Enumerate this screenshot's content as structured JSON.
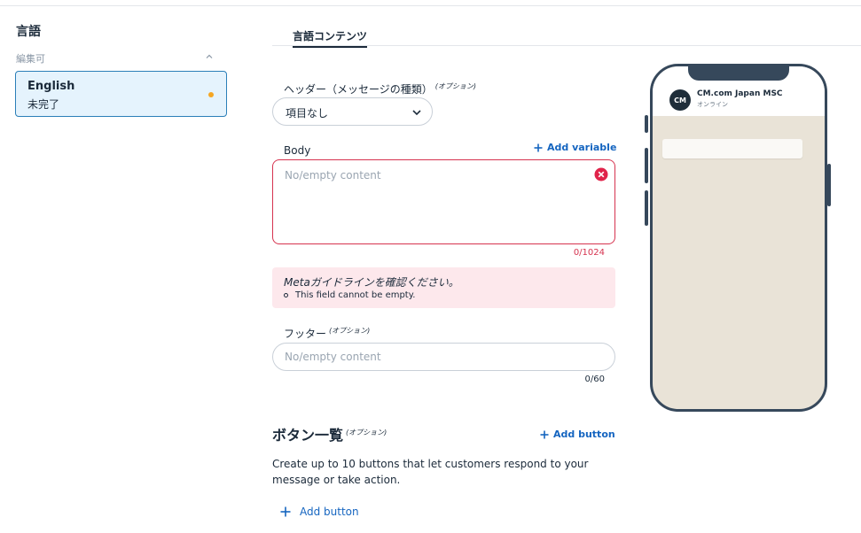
{
  "sidebar": {
    "title": "言語",
    "section_label": "編集可",
    "languages": [
      {
        "name": "English",
        "status": "未完了",
        "status_color": "#f5a623"
      }
    ]
  },
  "tabs": [
    {
      "label": "言語コンテンツ",
      "active": true
    }
  ],
  "form": {
    "header_label": "ヘッダー（メッセージの種類）",
    "header_optional": "(オプション)",
    "header_select_value": "項目なし",
    "body_label": "Body",
    "add_variable_label": "Add variable",
    "body_placeholder": "No/empty content",
    "body_counter": "0/1024",
    "error_title": "Metaガイドラインを確認ください。",
    "error_item": "This field cannot be empty.",
    "footer_label": "フッター",
    "footer_optional": "(オプション)",
    "footer_placeholder": "No/empty content",
    "footer_counter": "0/60",
    "buttons_title": "ボタン一覧",
    "buttons_optional": "(オプション)",
    "add_button_label": "Add button",
    "buttons_description": "Create up to 10 buttons that let customers respond to your message or take action.",
    "add_button_label_bottom": "Add button"
  },
  "preview": {
    "avatar_text": "CM",
    "contact_name": "CM.com Japan MSC",
    "contact_status": "オンライン"
  },
  "colors": {
    "accent": "#1565c0",
    "error": "#d6334f",
    "error_bg": "#fde8ec",
    "selected_bg": "#e5f3fd",
    "pending": "#f5a623"
  }
}
